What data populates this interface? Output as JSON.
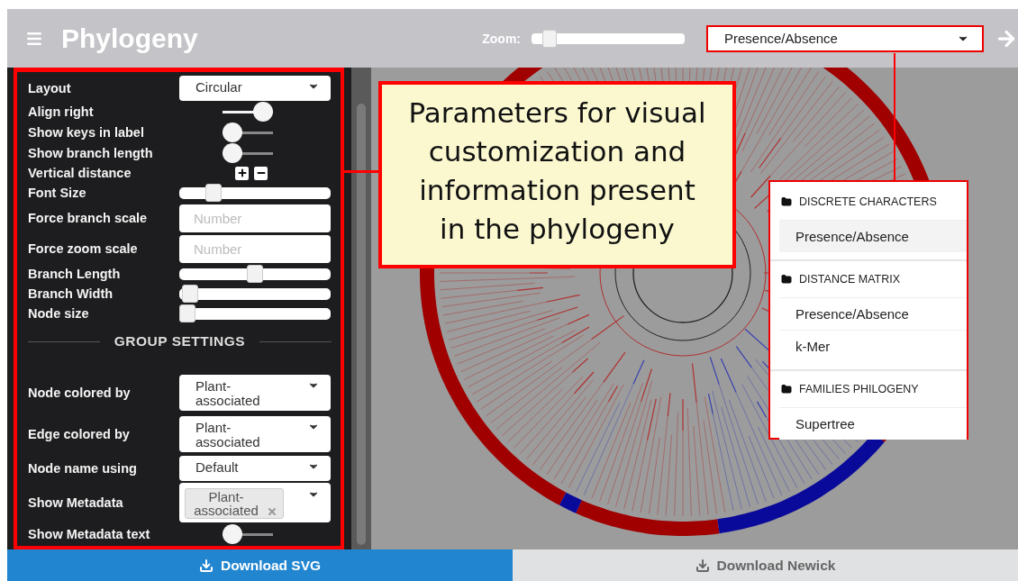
{
  "header": {
    "title": "Phylogeny",
    "zoom_label": "Zoom:",
    "zoom": {
      "level": 0.08
    },
    "dataset_select": {
      "value": "Presence/Absence"
    }
  },
  "settings": [
    {
      "kind": "select",
      "label": "Layout",
      "value": "Circular"
    },
    {
      "kind": "toggle",
      "label": "Align right",
      "on": true
    },
    {
      "kind": "toggle",
      "label": "Show keys in label",
      "on": false
    },
    {
      "kind": "toggle",
      "label": "Show branch length",
      "on": false
    },
    {
      "kind": "stepper",
      "label": "Vertical distance"
    },
    {
      "kind": "slider",
      "label": "Font Size",
      "level": 0.19
    },
    {
      "kind": "number",
      "label": "Force branch scale",
      "placeholder": "Number"
    },
    {
      "kind": "number",
      "label": "Force zoom scale",
      "placeholder": "Number"
    },
    {
      "kind": "slider",
      "label": "Branch Length",
      "level": 0.5
    },
    {
      "kind": "slider",
      "label": "Branch Width",
      "level": 0.02
    },
    {
      "kind": "slider",
      "label": "Node size",
      "level": 0.0
    }
  ],
  "group_settings": {
    "title": "GROUP SETTINGS",
    "rows": [
      {
        "kind": "select",
        "label": "Node colored by",
        "value": "Plant-associated"
      },
      {
        "kind": "select",
        "label": "Edge colored by",
        "value": "Plant-associated"
      },
      {
        "kind": "select",
        "label": "Node name using",
        "value": "Default"
      },
      {
        "kind": "multiselect",
        "label": "Show Metadata",
        "tags": [
          "Plant-associated"
        ]
      },
      {
        "kind": "toggle",
        "label": "Show Metadata text",
        "on": false
      }
    ]
  },
  "footer": [
    {
      "label": "Download SVG",
      "selected": true
    },
    {
      "label": "Download Newick",
      "selected": false
    }
  ],
  "callout": {
    "text": "Parameters for visual customization and information present in the phylogeny"
  },
  "dropdown_menu": {
    "groups": [
      {
        "title": "DISCRETE CHARACTERS",
        "items": [
          {
            "label": "Presence/Absence",
            "selected": true
          }
        ]
      },
      {
        "title": "DISTANCE MATRIX",
        "items": [
          {
            "label": "Presence/Absence",
            "selected": false
          },
          {
            "label": "k-Mer",
            "selected": false
          }
        ]
      },
      {
        "title": "FAMILIES PHILOGENY",
        "items": [
          {
            "label": "Supertree",
            "selected": false
          }
        ]
      }
    ]
  }
}
